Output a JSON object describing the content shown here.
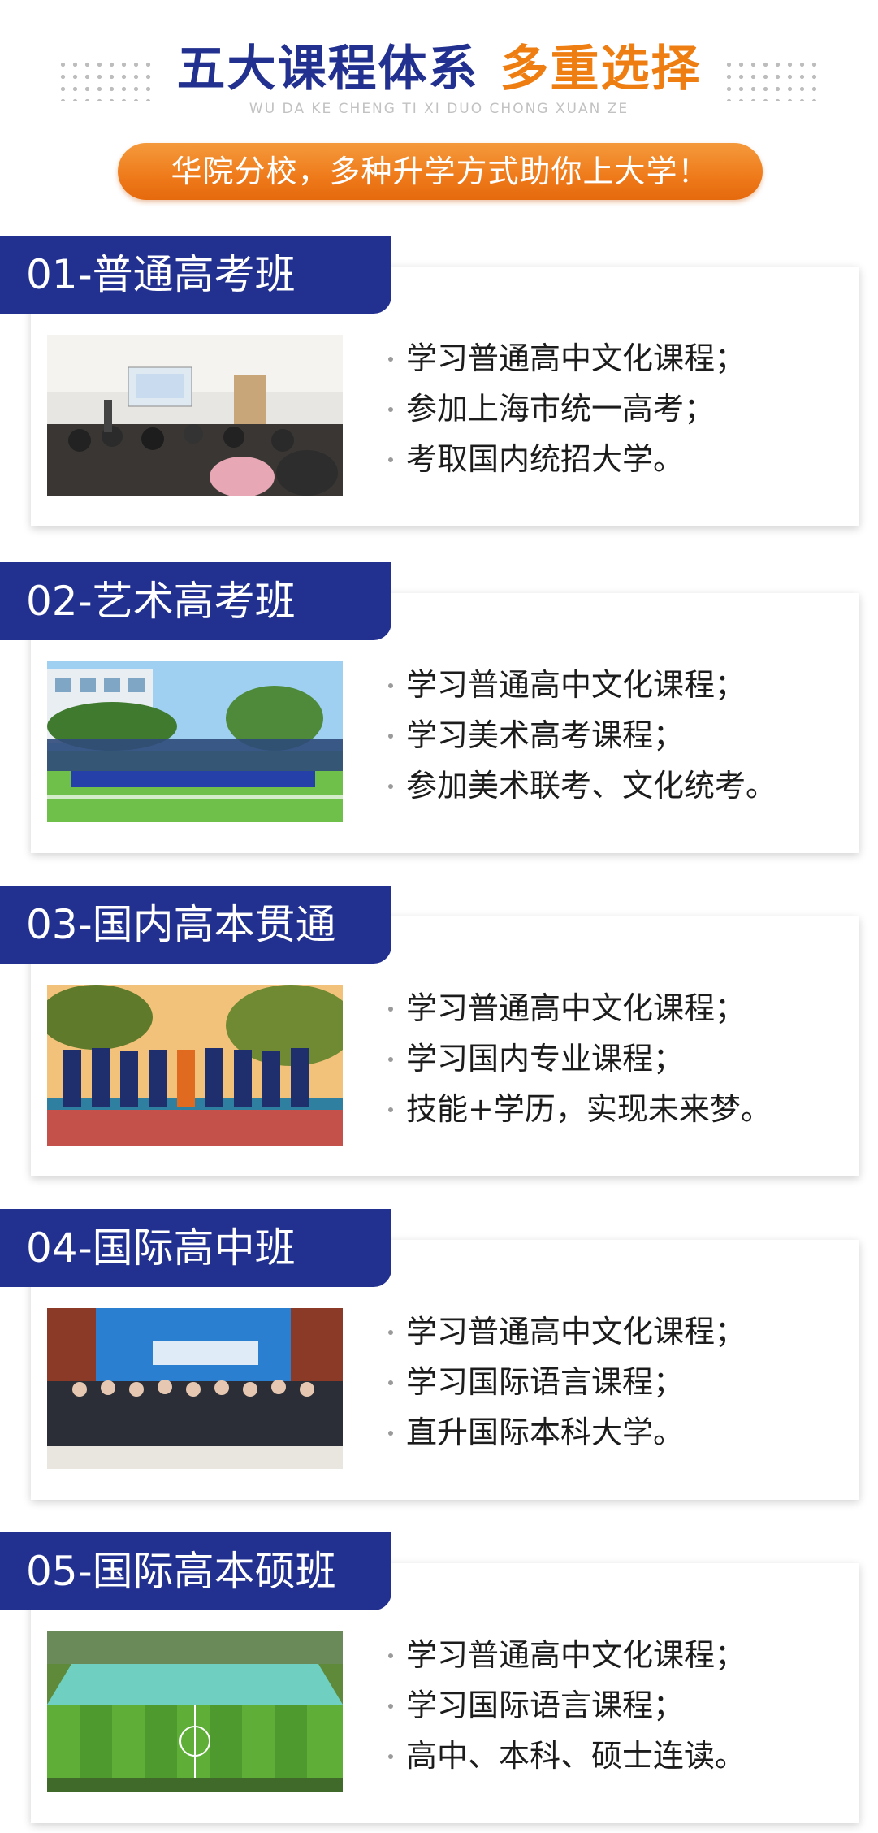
{
  "header": {
    "title_blue": "五大课程体系",
    "title_orange": "多重选择",
    "subtitle_en": "WU DA KE CHENG TI XI   DUO CHONG XUAN ZE",
    "banner": "华院分校，多种升学方式助你上大学！",
    "colors": {
      "blue": "#22308f",
      "orange": "#ee7e12"
    }
  },
  "courses": [
    {
      "label": "01-普通高考班",
      "photo": "classroom-photo",
      "bullets": [
        "学习普通高中文化课程；",
        "参加上海市统一高考；",
        "考取国内统招大学。"
      ]
    },
    {
      "label": "02-艺术高考班",
      "photo": "art-group-photo",
      "bullets": [
        "学习普通高中文化课程；",
        "学习美术高考课程；",
        "参加美术联考、文化统考。"
      ]
    },
    {
      "label": "03-国内高本贯通",
      "photo": "basketball-team-photo",
      "bullets": [
        "学习普通高中文化课程；",
        "学习国内专业课程；",
        "技能+学历，实现未来梦。"
      ]
    },
    {
      "label": "04-国际高中班",
      "photo": "graduation-photo",
      "bullets": [
        "学习普通高中文化课程；",
        "学习国际语言课程；",
        "直升国际本科大学。"
      ]
    },
    {
      "label": "05-国际高本硕班",
      "photo": "sports-field-photo",
      "bullets": [
        "学习普通高中文化课程；",
        "学习国际语言课程；",
        "高中、本科、硕士连读。"
      ]
    }
  ]
}
